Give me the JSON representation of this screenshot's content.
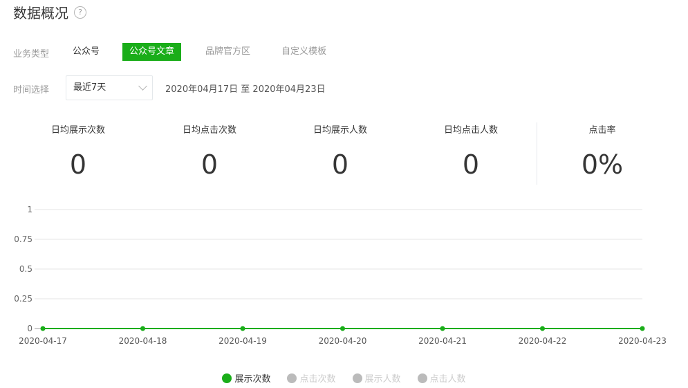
{
  "header": {
    "title": "数据概况",
    "help_glyph": "?"
  },
  "business": {
    "label": "业务类型",
    "tabs": [
      {
        "label": "公众号",
        "state": "normal"
      },
      {
        "label": "公众号文章",
        "state": "active"
      },
      {
        "label": "品牌官方区",
        "state": "normal"
      },
      {
        "label": "自定义模板",
        "state": "normal"
      }
    ]
  },
  "time": {
    "label": "时间选择",
    "select_value": "最近7天",
    "range_text": "2020年04月17日 至 2020年04月23日"
  },
  "stats": [
    {
      "label": "日均展示次数",
      "value": "0"
    },
    {
      "label": "日均点击次数",
      "value": "0"
    },
    {
      "label": "日均展示人数",
      "value": "0"
    },
    {
      "label": "日均点击人数",
      "value": "0"
    },
    {
      "label": "点击率",
      "value": "0%"
    }
  ],
  "colors": {
    "accent": "#1aad19",
    "grid": "#e6e6e6",
    "muted": "#bbbbbb"
  },
  "chart_data": {
    "type": "line",
    "categories": [
      "2020-04-17",
      "2020-04-18",
      "2020-04-19",
      "2020-04-20",
      "2020-04-21",
      "2020-04-22",
      "2020-04-23"
    ],
    "yticks": [
      "0",
      "0.25",
      "0.5",
      "0.75",
      "1"
    ],
    "ylim": [
      0,
      1
    ],
    "series": [
      {
        "name": "展示次数",
        "values": [
          0,
          0,
          0,
          0,
          0,
          0,
          0
        ],
        "visible": true
      },
      {
        "name": "点击次数",
        "values": [
          0,
          0,
          0,
          0,
          0,
          0,
          0
        ],
        "visible": false
      },
      {
        "name": "展示人数",
        "values": [
          0,
          0,
          0,
          0,
          0,
          0,
          0
        ],
        "visible": false
      },
      {
        "name": "点击人数",
        "values": [
          0,
          0,
          0,
          0,
          0,
          0,
          0
        ],
        "visible": false
      }
    ],
    "grid": true,
    "legend": "bottom"
  }
}
